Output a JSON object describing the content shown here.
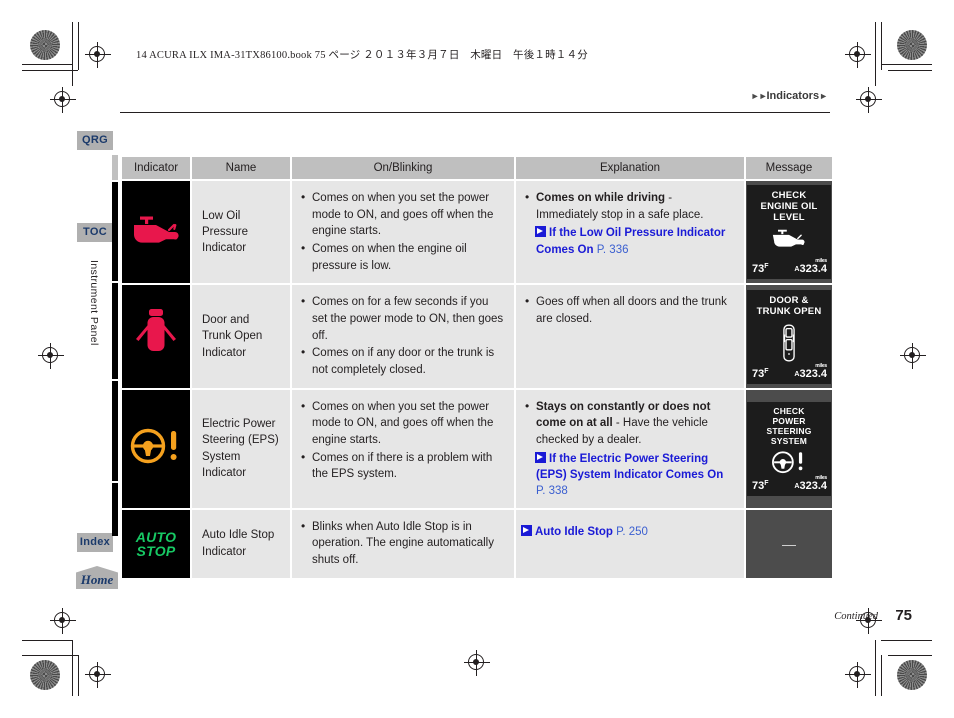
{
  "page": {
    "book_line": "14 ACURA ILX IMA-31TX86100.book  75 ページ  ２０１３年３月７日　木曜日　午後１時１４分",
    "breadcrumb": "Indicators",
    "section_label": "Instrument Panel",
    "continued": "Continued",
    "page_number": "75"
  },
  "tabs": [
    {
      "label": "QRG"
    },
    {
      "label": "TOC"
    },
    {
      "label": "Index"
    },
    {
      "label": "Home"
    }
  ],
  "table": {
    "headers": [
      "Indicator",
      "Name",
      "On/Blinking",
      "Explanation",
      "Message"
    ],
    "rows": [
      {
        "icon_name": "low-oil-pressure-icon",
        "icon_color": "#e8174c",
        "name": "Low Oil Pressure Indicator",
        "on_blinking": [
          "Comes on when you set the power mode to ON, and goes off when the engine starts.",
          "Comes on when the engine oil pressure is low."
        ],
        "explanation_bold": "Comes on while driving",
        "explanation_rest": " - Immediately stop in a safe place.",
        "xref_text": "If the Low Oil Pressure Indicator Comes On",
        "xref_page": "P. 336",
        "message": {
          "title": [
            "CHECK",
            "ENGINE OIL",
            "LEVEL"
          ],
          "glyph": "oil-can-glyph",
          "temp": "73",
          "temp_unit": "F",
          "odo_prefix": "A",
          "odo": "323.4",
          "odo_unit": "miles"
        }
      },
      {
        "icon_name": "door-and-trunk-open-icon",
        "icon_color": "#e8174c",
        "name": "Door and Trunk Open Indicator",
        "on_blinking": [
          "Comes on for a few seconds if you set the power mode to ON, then goes off.",
          "Comes on if any door or the trunk is not completely closed."
        ],
        "explanation_plain": "Goes off when all doors and the trunk are closed.",
        "message": {
          "title": [
            "DOOR &",
            "TRUNK OPEN"
          ],
          "glyph": "car-open-glyph",
          "temp": "73",
          "temp_unit": "F",
          "odo_prefix": "A",
          "odo": "323.4",
          "odo_unit": "miles"
        }
      },
      {
        "icon_name": "electric-power-steering-icon",
        "icon_color": "#f5a11e",
        "name": "Electric Power Steering (EPS) System Indicator",
        "on_blinking": [
          "Comes on when you set the power mode to ON, and goes off when the engine starts.",
          "Comes on if there is a problem with the EPS system."
        ],
        "explanation_bold": "Stays on constantly or does not come on at all",
        "explanation_rest": " - Have the vehicle checked by a dealer.",
        "xref_text": "If the Electric Power Steering (EPS) System Indicator Comes On",
        "xref_page": "P. 338",
        "message": {
          "title": [
            "CHECK",
            "POWER",
            "STEERING",
            "SYSTEM"
          ],
          "glyph": "steering-wheel-glyph",
          "temp": "73",
          "temp_unit": "F",
          "odo_prefix": "A",
          "odo": "323.4",
          "odo_unit": "miles"
        }
      },
      {
        "icon_name": "auto-idle-stop-icon",
        "icon_color": "#17c964",
        "icon_text_line1": "AUTO",
        "icon_text_line2": "STOP",
        "name": "Auto Idle Stop Indicator",
        "on_blinking": [
          "Blinks when Auto Idle Stop is in operation. The engine automatically shuts off."
        ],
        "xref_text": "Auto Idle Stop",
        "xref_page": "P. 250",
        "message_dash": "—"
      }
    ]
  }
}
